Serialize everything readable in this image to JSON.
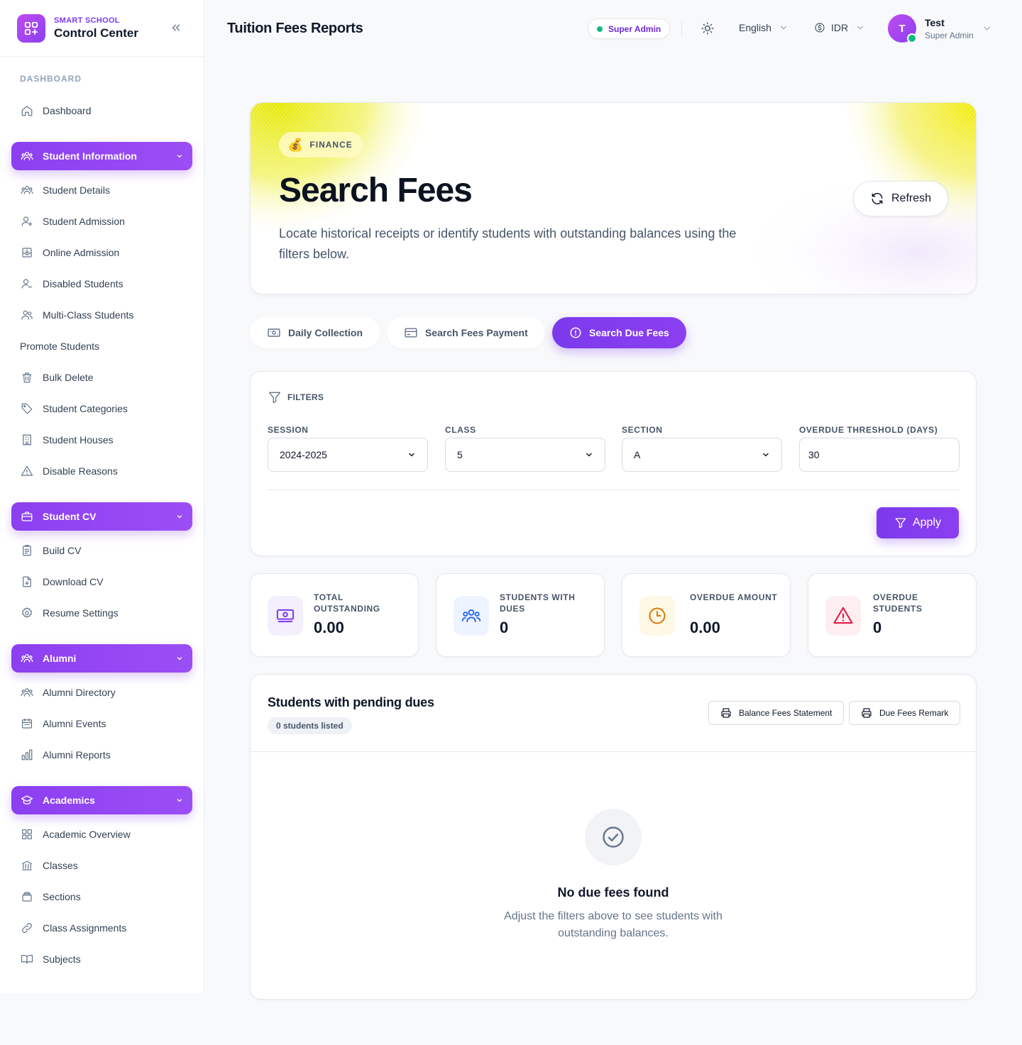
{
  "sidebar": {
    "brand_small": "SMART SCHOOL",
    "brand_big": "Control Center",
    "section_label": "DASHBOARD",
    "dashboard_item": "Dashboard",
    "groups": {
      "student_information": "Student Information",
      "student_cv": "Student CV",
      "alumni": "Alumni",
      "academics": "Academics"
    },
    "student_information_items": [
      "Student Details",
      "Student Admission",
      "Online Admission",
      "Disabled Students",
      "Multi-Class Students",
      "Promote Students",
      "Bulk Delete",
      "Student Categories",
      "Student Houses",
      "Disable Reasons"
    ],
    "student_cv_items": [
      "Build CV",
      "Download CV",
      "Resume Settings"
    ],
    "alumni_items": [
      "Alumni Directory",
      "Alumni Events",
      "Alumni Reports"
    ],
    "academics_items": [
      "Academic Overview",
      "Classes",
      "Sections",
      "Class Assignments",
      "Subjects"
    ]
  },
  "header": {
    "title": "Tuition Fees Reports",
    "role_pill": "Super Admin",
    "language": "English",
    "currency": "IDR",
    "avatar_initial": "T",
    "user_name": "Test",
    "user_role": "Super Admin"
  },
  "hero": {
    "badge_emoji": "💰",
    "badge": "FINANCE",
    "title": "Search Fees",
    "description": "Locate historical receipts or identify students with outstanding balances using the filters below.",
    "refresh_label": "Refresh"
  },
  "tabs": {
    "daily_collection": "Daily Collection",
    "search_fees_payment": "Search Fees Payment",
    "search_due_fees": "Search Due Fees"
  },
  "filters": {
    "heading": "FILTERS",
    "session_label": "SESSION",
    "session_value": "2024-2025",
    "class_label": "CLASS",
    "class_value": "5",
    "section_label": "SECTION",
    "section_value": "A",
    "threshold_label": "OVERDUE THRESHOLD (DAYS)",
    "threshold_value": "30",
    "apply_label": "Apply"
  },
  "stats": {
    "total_outstanding": {
      "label": "TOTAL OUTSTANDING",
      "value": "0.00"
    },
    "students_with_dues": {
      "label": "STUDENTS WITH DUES",
      "value": "0"
    },
    "overdue_amount": {
      "label": "OVERDUE AMOUNT",
      "value": "0.00"
    },
    "overdue_students": {
      "label": "OVERDUE STUDENTS",
      "value": "0"
    }
  },
  "table": {
    "title": "Students with pending dues",
    "count": "0 students listed",
    "balance_statement_label": "Balance Fees Statement",
    "due_remark_label": "Due Fees Remark",
    "empty_title": "No due fees found",
    "empty_desc": "Adjust the filters above to see students with outstanding balances."
  },
  "colors": {
    "accent": "#7c3aed",
    "success": "#10b981",
    "warning": "#d97706",
    "danger": "#e11d48",
    "info": "#2563eb"
  }
}
